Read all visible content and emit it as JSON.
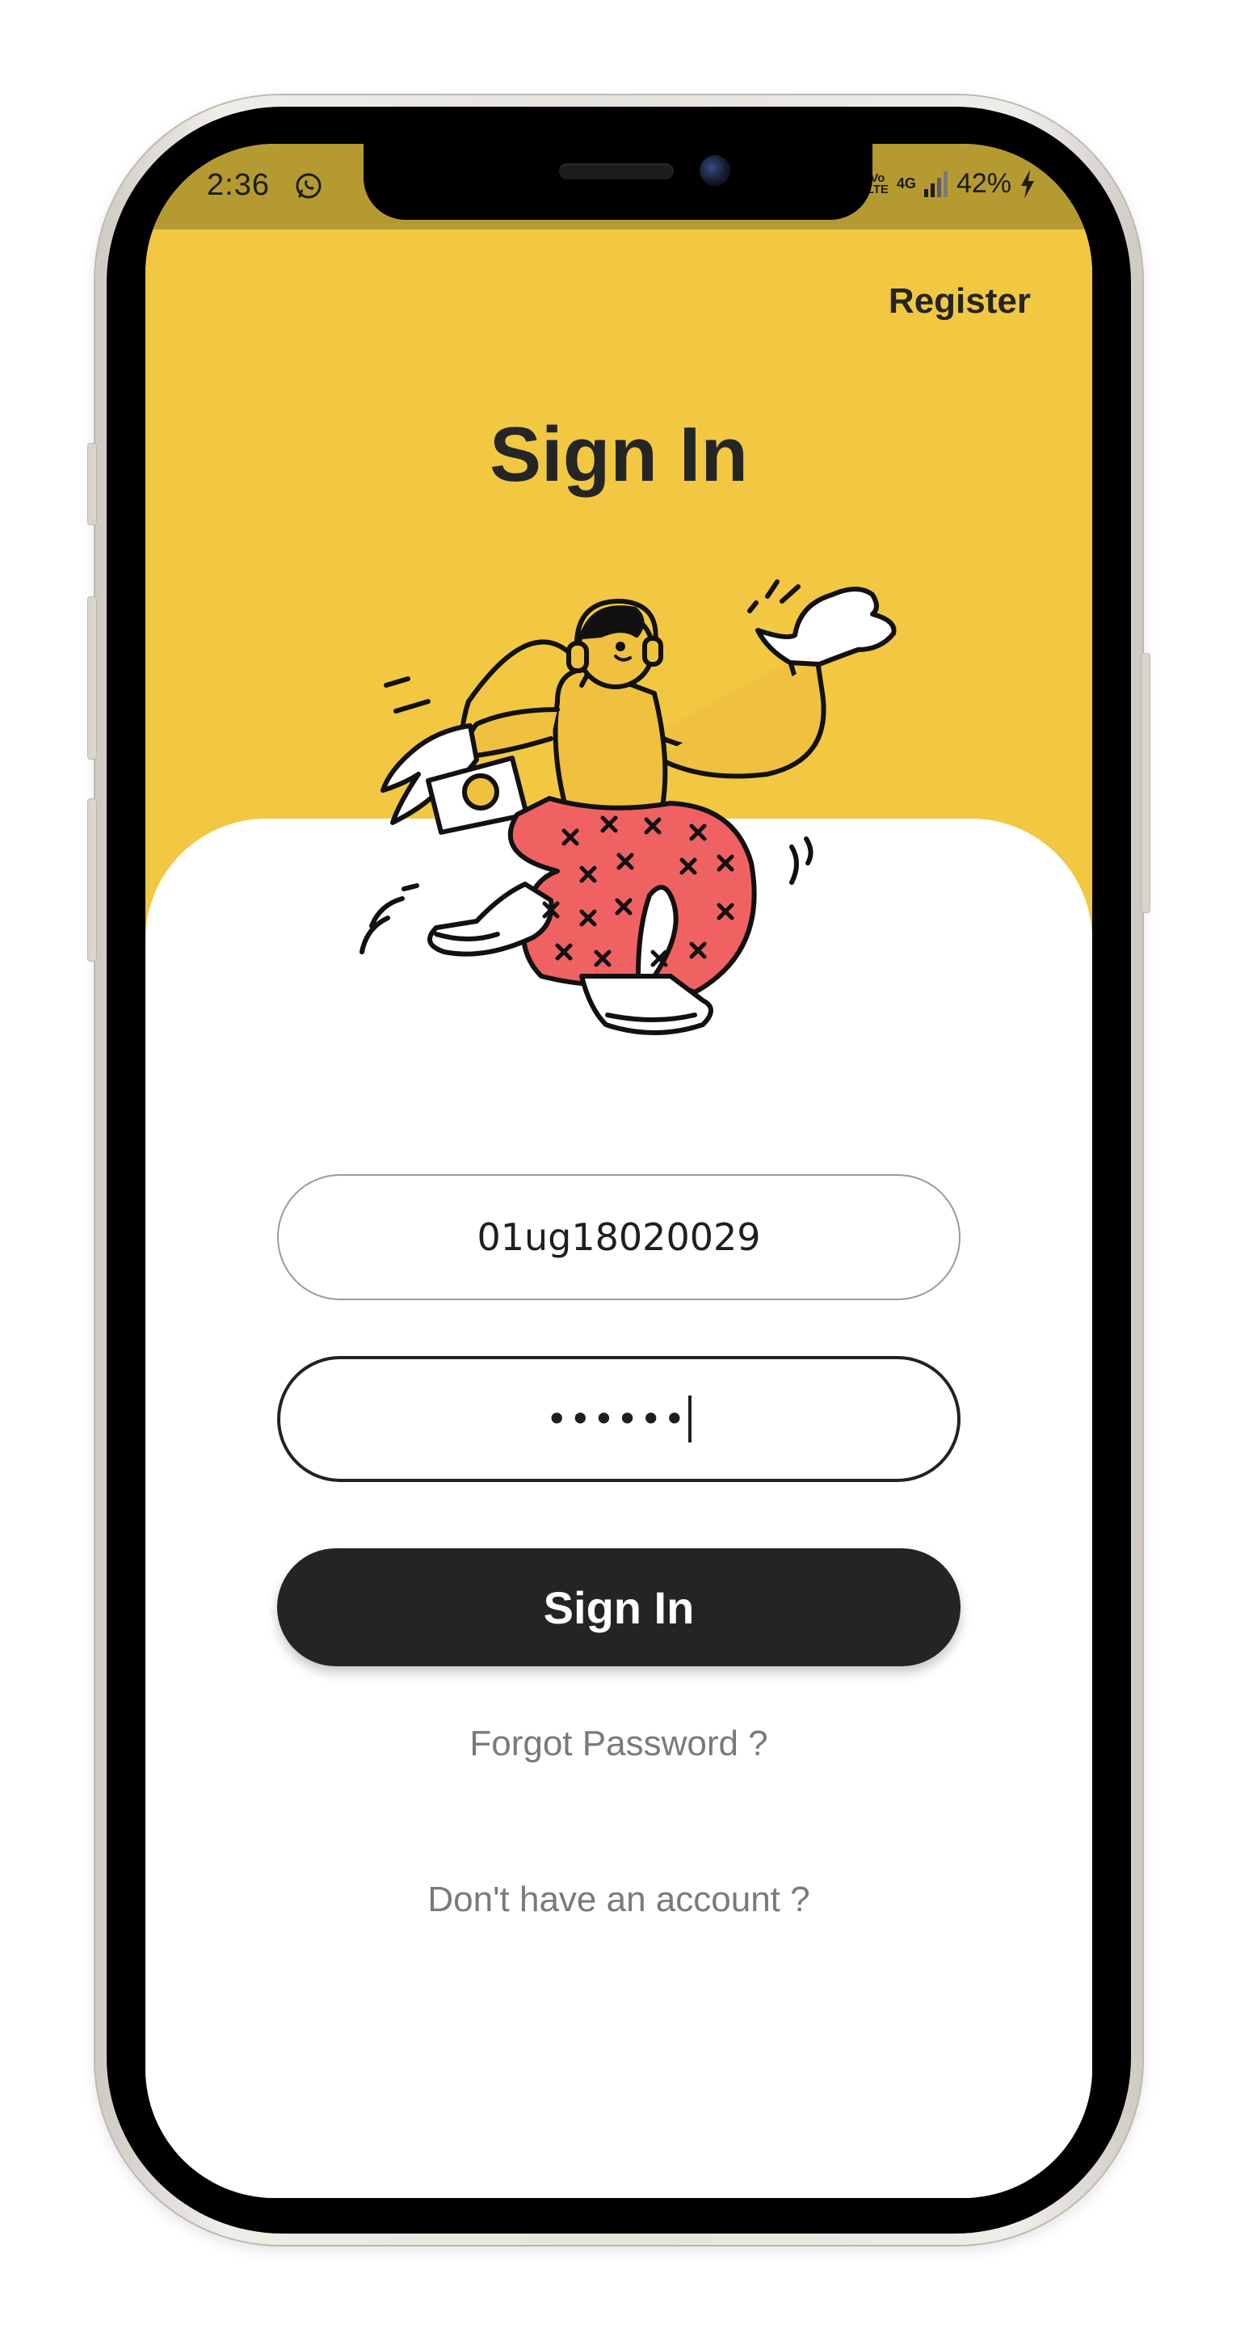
{
  "status_bar": {
    "time": "2:36",
    "volte_top": "Vo",
    "volte_bottom": "LTE",
    "network": "4G",
    "battery": "42%",
    "icons": [
      "whatsapp-icon",
      "volte-icon",
      "signal-icon",
      "battery-charging-icon"
    ]
  },
  "header": {
    "register_label": "Register",
    "title": "Sign In"
  },
  "form": {
    "username_value": "01ug18020029",
    "password_value": "••••••",
    "signin_label": "Sign In",
    "forgot_label": "Forgot Password ?",
    "no_account_label": "Don't have an account ?"
  },
  "colors": {
    "header_yellow": "#f2c842",
    "status_bar": "#b59a31",
    "button_dark": "#232426",
    "pants_red": "#f06262"
  }
}
